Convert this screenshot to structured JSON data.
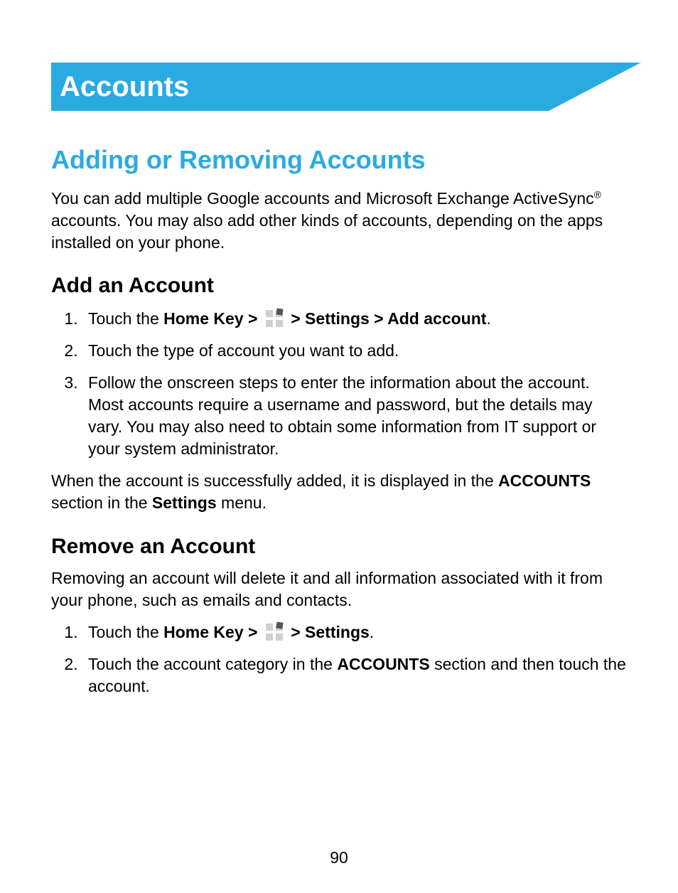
{
  "banner": {
    "title": "Accounts"
  },
  "section_title": "Adding or Removing Accounts",
  "intro": {
    "part1": "You can add multiple Google accounts and Microsoft Exchange ActiveSync",
    "reg": "®",
    "part2": " accounts. You may also add other kinds of accounts, depending on the apps installed on your phone."
  },
  "add": {
    "heading": "Add an Account",
    "step1_a": "Touch the ",
    "step1_b": "Home Key > ",
    "step1_c": " > Settings > Add account",
    "step1_d": ".",
    "step2": "Touch the type of account you want to add.",
    "step3": "Follow the onscreen steps to enter the information about the account. Most accounts require a username and password, but the details may vary. You may also need to obtain some information from IT support or your system administrator.",
    "note_a": "When the account is successfully added, it is displayed in the ",
    "note_b": "ACCOUNTS",
    "note_c": " section in the ",
    "note_d": "Settings",
    "note_e": " menu."
  },
  "remove": {
    "heading": "Remove an Account",
    "intro": "Removing an account will delete it and all information associated with it from your phone, such as emails and contacts.",
    "step1_a": "Touch the ",
    "step1_b": "Home Key > ",
    "step1_c": " > Settings",
    "step1_d": ".",
    "step2_a": "Touch the account category in the ",
    "step2_b": "ACCOUNTS",
    "step2_c": " section and then touch the account."
  },
  "page_number": "90"
}
